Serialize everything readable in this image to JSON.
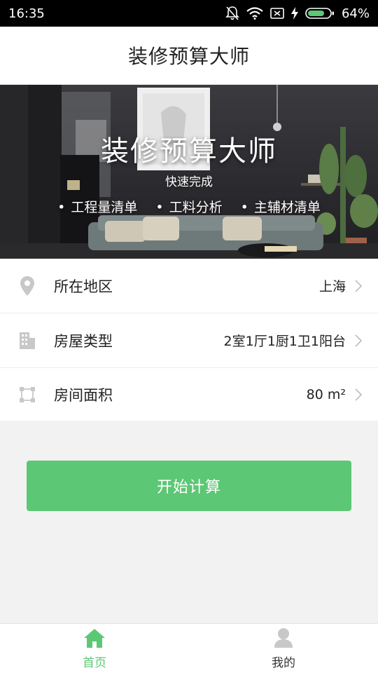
{
  "status_bar": {
    "time": "16:35",
    "battery": "64%",
    "icons": [
      "notification-off-icon",
      "wifi-icon",
      "sim-off-icon",
      "charging-bolt-icon",
      "battery-icon"
    ]
  },
  "header": {
    "title": "装修预算大师"
  },
  "banner": {
    "title": "装修预算大师",
    "subtitle": "快速完成",
    "features": [
      "工程量清单",
      "工料分析",
      "主辅材清单"
    ]
  },
  "form": {
    "region": {
      "label": "所在地区",
      "value": "上海",
      "icon": "location-pin-icon"
    },
    "house_type": {
      "label": "房屋类型",
      "value": "2室1厅1厨1卫1阳台",
      "icon": "building-icon"
    },
    "area": {
      "label": "房间面积",
      "value": "80 m²",
      "icon": "area-frame-icon"
    }
  },
  "actions": {
    "calculate_label": "开始计算"
  },
  "tabs": [
    {
      "label": "首页",
      "icon": "home-icon",
      "active": true
    },
    {
      "label": "我的",
      "icon": "user-icon",
      "active": false
    }
  ],
  "colors": {
    "accent": "#5cc775",
    "icon_gray": "#c8c8c8",
    "background": "#f2f2f2"
  }
}
